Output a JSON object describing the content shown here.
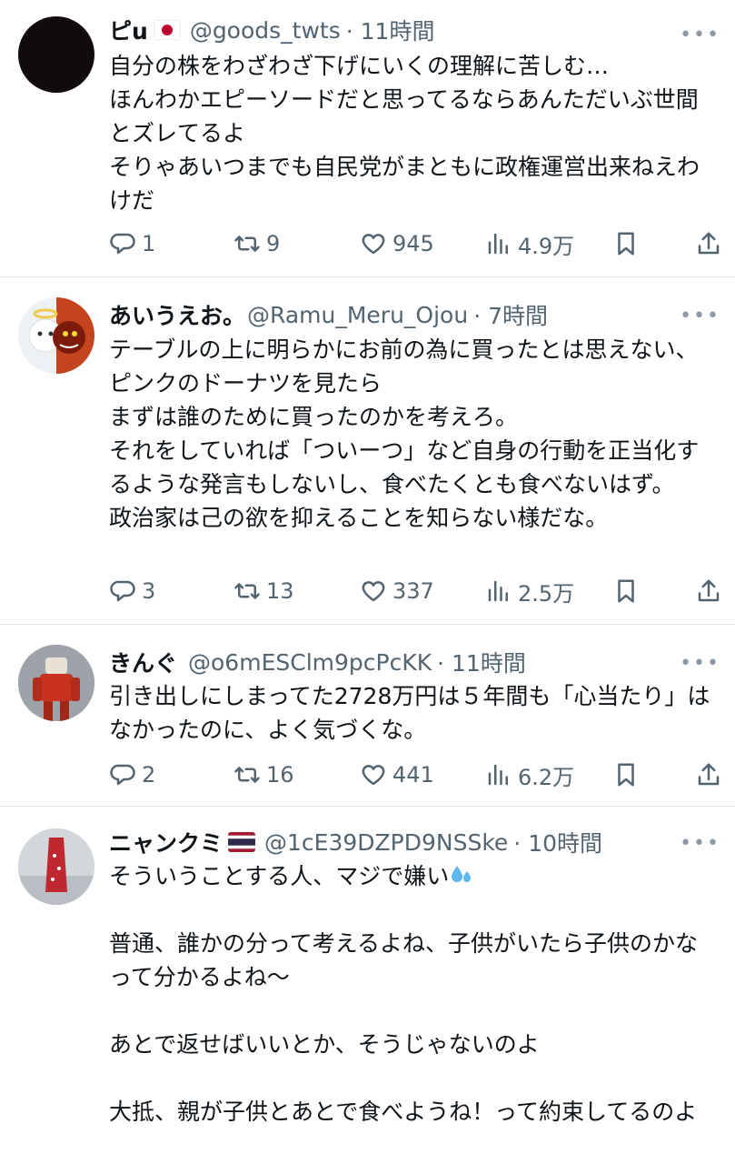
{
  "tweets": [
    {
      "name": "ピu",
      "flag": "Japan",
      "handle": "@goods_twts",
      "time": "· 11時間",
      "text": "自分の株をわざわざ下げにいくの理解に苦しむ…\nほんわかエピーソードだと思ってるならあんただいぶ世間とズレてるよ\nそりゃあいつまでも自民党がまともに政権運営出来ねえわけだ",
      "replies": "1",
      "retweets": "9",
      "likes": "945",
      "views": "4.9万"
    },
    {
      "name": "あいうえお。",
      "handle": "@Ramu_Meru_Ojou",
      "time": "· 7時間",
      "text": "テーブルの上に明らかにお前の為に買ったとは思えない、ピンクのドーナツを見たら\nまずは誰のために買ったのかを考えろ。\nそれをしていれば「ついーつ」など自身の行動を正当化するような発言もしないし、食べたくとも食べないはず。\n政治家は己の欲を抑えることを知らない様だな。",
      "replies": "3",
      "retweets": "13",
      "likes": "337",
      "views": "2.5万"
    },
    {
      "name": "きんぐ",
      "handle": "@o6mESClm9pcPcKK",
      "time": "· 11時間",
      "text": "引き出しにしまってた2728万円は５年間も「心当たり」はなかったのに、よく気づくな。",
      "replies": "2",
      "retweets": "16",
      "likes": "441",
      "views": "6.2万"
    },
    {
      "name": "ニャンクミ",
      "flag": "Thailand",
      "handle": "@1cE39DZPD9NSSke",
      "time": "· 10時間",
      "text": "そういうことする人、マジで嫌い",
      "text2": "普通、誰かの分って考えるよね、子供がいたら子供のかなって分かるよね〜\n\nあとで返せばいいとか、そうじゃないのよ\n\n大抵、親が子供とあとで食べようね！って約束してるのよ"
    }
  ],
  "colors": {
    "text": "#0f1419",
    "secondary": "#536471",
    "divider": "#e6e9ec"
  },
  "icons": [
    "reply-icon",
    "retweet-icon",
    "like-icon",
    "views-icon",
    "bookmark-icon",
    "share-icon",
    "more-icon",
    "sweat-drops-icon"
  ]
}
